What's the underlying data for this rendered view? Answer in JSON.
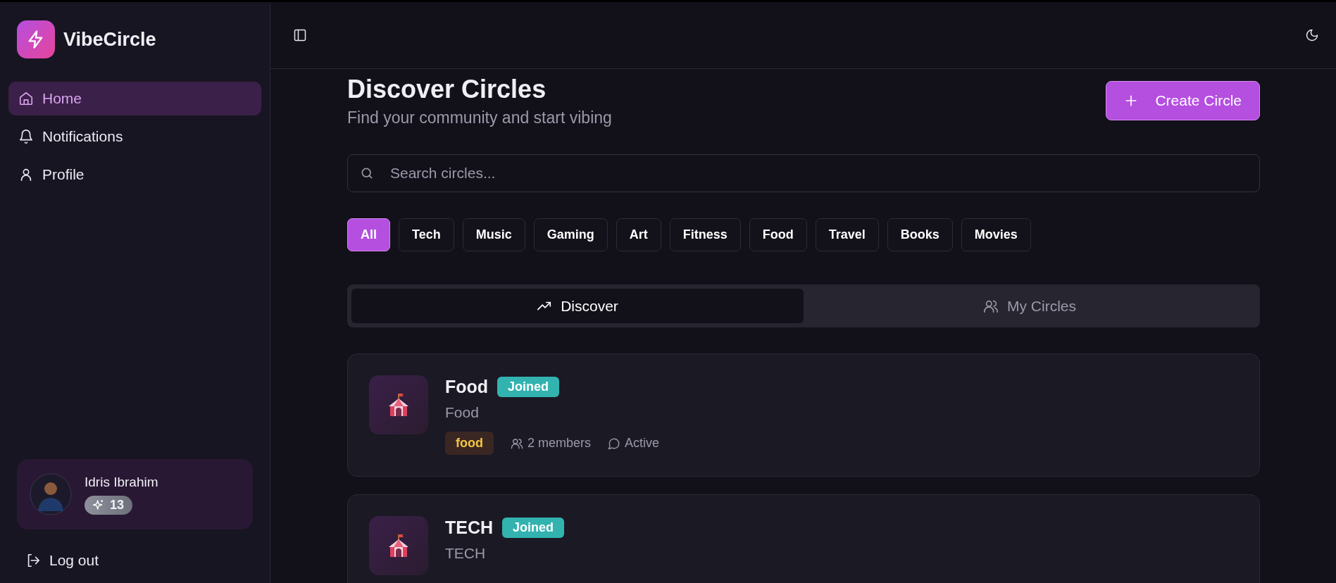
{
  "app": {
    "name": "VibeCircle"
  },
  "nav": [
    {
      "label": "Home",
      "selected": true
    },
    {
      "label": "Notifications",
      "selected": false
    },
    {
      "label": "Profile",
      "selected": false
    }
  ],
  "user": {
    "name": "Idris Ibrahim",
    "points": "13"
  },
  "logout": "Log out",
  "page": {
    "title": "Discover Circles",
    "subtitle": "Find your community and start vibing",
    "create_button": "Create Circle"
  },
  "search": {
    "placeholder": "Search circles..."
  },
  "categories": [
    {
      "label": "All",
      "selected": true
    },
    {
      "label": "Tech",
      "selected": false
    },
    {
      "label": "Music",
      "selected": false
    },
    {
      "label": "Gaming",
      "selected": false
    },
    {
      "label": "Art",
      "selected": false
    },
    {
      "label": "Fitness",
      "selected": false
    },
    {
      "label": "Food",
      "selected": false
    },
    {
      "label": "Travel",
      "selected": false
    },
    {
      "label": "Books",
      "selected": false
    },
    {
      "label": "Movies",
      "selected": false
    }
  ],
  "tabs": [
    {
      "label": "Discover",
      "selected": true
    },
    {
      "label": "My Circles",
      "selected": false
    }
  ],
  "circles": [
    {
      "name": "Food",
      "badge": "Joined",
      "description": "Food",
      "tag": "food",
      "members": "2 members",
      "activity": "Active"
    },
    {
      "name": "TECH",
      "badge": "Joined",
      "description": "TECH"
    }
  ]
}
